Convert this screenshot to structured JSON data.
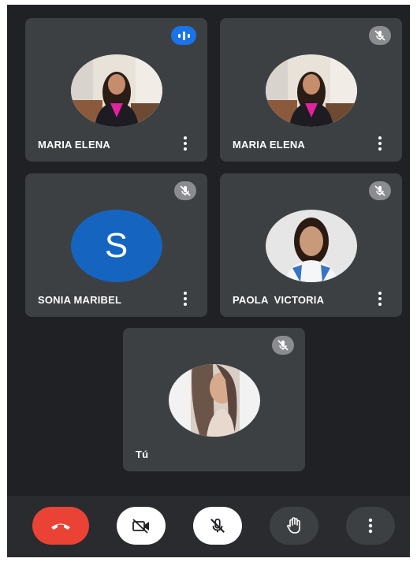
{
  "participants": [
    {
      "name": "MARIA ELENA",
      "status": "speaking"
    },
    {
      "name": "MARIA ELENA",
      "status": "muted"
    },
    {
      "name": "SONIA MARIBEL",
      "status": "muted",
      "initial": "S",
      "avatar_color": "#1565c0"
    },
    {
      "name": "PAOLA  VICTORIA",
      "status": "muted"
    },
    {
      "name": "Tú",
      "status": "muted"
    }
  ],
  "colors": {
    "background": "#202124",
    "tile": "#3c4043",
    "end_call": "#ea4335",
    "speaking_badge": "#1a73e8"
  },
  "controls": [
    {
      "name": "end-call",
      "icon": "phone-hangup-icon"
    },
    {
      "name": "camera-toggle",
      "icon": "video-off-icon"
    },
    {
      "name": "mic-toggle",
      "icon": "mic-off-icon"
    },
    {
      "name": "raise-hand",
      "icon": "hand-icon"
    },
    {
      "name": "more-options",
      "icon": "more-vertical-icon"
    }
  ]
}
